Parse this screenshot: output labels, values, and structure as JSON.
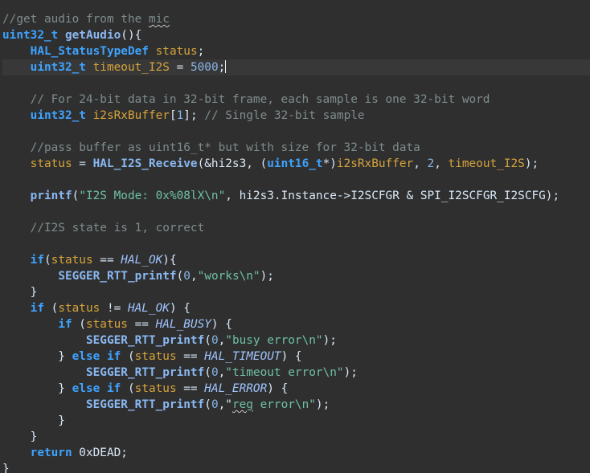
{
  "code": {
    "language": "c",
    "current_line": 4,
    "lines": [
      [
        {
          "t": "//get audio from the ",
          "c": "cm"
        },
        {
          "t": "mic",
          "c": "cm sq"
        }
      ],
      [
        {
          "t": "uint32_t",
          "c": "ty"
        },
        {
          "t": " ",
          "c": "plain"
        },
        {
          "t": "getAudio",
          "c": "fn"
        },
        {
          "t": "(){",
          "c": "plain"
        }
      ],
      [
        {
          "t": "    ",
          "c": "plain"
        },
        {
          "t": "HAL_StatusTypeDef",
          "c": "ty"
        },
        {
          "t": " ",
          "c": "plain"
        },
        {
          "t": "status",
          "c": "var"
        },
        {
          "t": ";",
          "c": "plain"
        }
      ],
      [
        {
          "t": "    ",
          "c": "plain"
        },
        {
          "t": "uint32_t",
          "c": "ty"
        },
        {
          "t": " ",
          "c": "plain"
        },
        {
          "t": "timeout_I2S",
          "c": "var"
        },
        {
          "t": " = ",
          "c": "plain"
        },
        {
          "t": "5000",
          "c": "num"
        },
        {
          "t": ";",
          "c": "plain"
        }
      ],
      [
        {
          "t": "",
          "c": "plain"
        }
      ],
      [
        {
          "t": "    ",
          "c": "plain"
        },
        {
          "t": "// For 24-bit data in 32-bit frame, each sample is one 32-bit word",
          "c": "cm"
        }
      ],
      [
        {
          "t": "    ",
          "c": "plain"
        },
        {
          "t": "uint32_t",
          "c": "ty"
        },
        {
          "t": " ",
          "c": "plain"
        },
        {
          "t": "i2sRxBuffer",
          "c": "var"
        },
        {
          "t": "[",
          "c": "plain"
        },
        {
          "t": "1",
          "c": "num"
        },
        {
          "t": "]; ",
          "c": "plain"
        },
        {
          "t": "// Single 32-bit sample",
          "c": "cm"
        }
      ],
      [
        {
          "t": "",
          "c": "plain"
        }
      ],
      [
        {
          "t": "    ",
          "c": "plain"
        },
        {
          "t": "//pass buffer as uint16_t* but with size for 32-bit data",
          "c": "cm"
        }
      ],
      [
        {
          "t": "    ",
          "c": "plain"
        },
        {
          "t": "status",
          "c": "var"
        },
        {
          "t": " = ",
          "c": "plain"
        },
        {
          "t": "HAL_I2S_Receive",
          "c": "fn"
        },
        {
          "t": "(&hi2s3, (",
          "c": "plain"
        },
        {
          "t": "uint16_t",
          "c": "ty"
        },
        {
          "t": "*)",
          "c": "plain"
        },
        {
          "t": "i2sRxBuffer",
          "c": "var"
        },
        {
          "t": ", ",
          "c": "plain"
        },
        {
          "t": "2",
          "c": "num"
        },
        {
          "t": ", ",
          "c": "plain"
        },
        {
          "t": "timeout_I2S",
          "c": "var"
        },
        {
          "t": ");",
          "c": "plain"
        }
      ],
      [
        {
          "t": "",
          "c": "plain"
        }
      ],
      [
        {
          "t": "    ",
          "c": "plain"
        },
        {
          "t": "printf",
          "c": "fn"
        },
        {
          "t": "(",
          "c": "plain"
        },
        {
          "t": "\"I2S Mode: 0x%08lX\\n\"",
          "c": "str"
        },
        {
          "t": ", hi2s3.Instance->I2SCFGR & SPI_I2SCFGR_I2SCFG);",
          "c": "plain"
        }
      ],
      [
        {
          "t": "",
          "c": "plain"
        }
      ],
      [
        {
          "t": "    ",
          "c": "plain"
        },
        {
          "t": "//I2S state is 1, correct",
          "c": "cm"
        }
      ],
      [
        {
          "t": "",
          "c": "plain"
        }
      ],
      [
        {
          "t": "    ",
          "c": "plain"
        },
        {
          "t": "if",
          "c": "kw"
        },
        {
          "t": "(",
          "c": "plain"
        },
        {
          "t": "status",
          "c": "var"
        },
        {
          "t": " == ",
          "c": "plain"
        },
        {
          "t": "HAL_OK",
          "c": "mac"
        },
        {
          "t": "){",
          "c": "plain"
        }
      ],
      [
        {
          "t": "        ",
          "c": "plain"
        },
        {
          "t": "SEGGER_RTT_printf",
          "c": "fn"
        },
        {
          "t": "(",
          "c": "plain"
        },
        {
          "t": "0",
          "c": "num"
        },
        {
          "t": ",",
          "c": "plain"
        },
        {
          "t": "\"works\\n\"",
          "c": "str"
        },
        {
          "t": ");",
          "c": "plain"
        }
      ],
      [
        {
          "t": "    }",
          "c": "plain"
        }
      ],
      [
        {
          "t": "    ",
          "c": "plain"
        },
        {
          "t": "if",
          "c": "kw"
        },
        {
          "t": " (",
          "c": "plain"
        },
        {
          "t": "status",
          "c": "var"
        },
        {
          "t": " != ",
          "c": "plain"
        },
        {
          "t": "HAL_OK",
          "c": "mac"
        },
        {
          "t": ") {",
          "c": "plain"
        }
      ],
      [
        {
          "t": "        ",
          "c": "plain"
        },
        {
          "t": "if",
          "c": "kw"
        },
        {
          "t": " (",
          "c": "plain"
        },
        {
          "t": "status",
          "c": "var"
        },
        {
          "t": " == ",
          "c": "plain"
        },
        {
          "t": "HAL_BUSY",
          "c": "mac"
        },
        {
          "t": ") {",
          "c": "plain"
        }
      ],
      [
        {
          "t": "            ",
          "c": "plain"
        },
        {
          "t": "SEGGER_RTT_printf",
          "c": "fn"
        },
        {
          "t": "(",
          "c": "plain"
        },
        {
          "t": "0",
          "c": "num"
        },
        {
          "t": ",",
          "c": "plain"
        },
        {
          "t": "\"busy error\\n\"",
          "c": "str"
        },
        {
          "t": ");",
          "c": "plain"
        }
      ],
      [
        {
          "t": "        } ",
          "c": "plain"
        },
        {
          "t": "else if",
          "c": "kw"
        },
        {
          "t": " (",
          "c": "plain"
        },
        {
          "t": "status",
          "c": "var"
        },
        {
          "t": " == ",
          "c": "plain"
        },
        {
          "t": "HAL_TIMEOUT",
          "c": "mac"
        },
        {
          "t": ") {",
          "c": "plain"
        }
      ],
      [
        {
          "t": "            ",
          "c": "plain"
        },
        {
          "t": "SEGGER_RTT_printf",
          "c": "fn"
        },
        {
          "t": "(",
          "c": "plain"
        },
        {
          "t": "0",
          "c": "num"
        },
        {
          "t": ",",
          "c": "plain"
        },
        {
          "t": "\"timeout error\\n\"",
          "c": "str"
        },
        {
          "t": ");",
          "c": "plain"
        }
      ],
      [
        {
          "t": "        } ",
          "c": "plain"
        },
        {
          "t": "else if",
          "c": "kw"
        },
        {
          "t": " (",
          "c": "plain"
        },
        {
          "t": "status",
          "c": "var"
        },
        {
          "t": " == ",
          "c": "plain"
        },
        {
          "t": "HAL_ERROR",
          "c": "mac"
        },
        {
          "t": ") {",
          "c": "plain"
        }
      ],
      [
        {
          "t": "            ",
          "c": "plain"
        },
        {
          "t": "SEGGER_RTT_printf",
          "c": "fn"
        },
        {
          "t": "(",
          "c": "plain"
        },
        {
          "t": "0",
          "c": "num"
        },
        {
          "t": ",\"",
          "c": "plain str"
        },
        {
          "t": "reg",
          "c": "str sq"
        },
        {
          "t": " error\\n\"",
          "c": "str"
        },
        {
          "t": ");",
          "c": "plain"
        }
      ],
      [
        {
          "t": "        }",
          "c": "plain"
        }
      ],
      [
        {
          "t": "    }",
          "c": "plain"
        }
      ],
      [
        {
          "t": "    ",
          "c": "plain"
        },
        {
          "t": "return",
          "c": "kw"
        },
        {
          "t": " 0xDEAD;",
          "c": "plain"
        }
      ],
      [
        {
          "t": "}",
          "c": "plain"
        }
      ]
    ]
  },
  "colors": {
    "background": "#2f2f2f",
    "current_line": "#383838",
    "comment": "#7f8c8d",
    "keyword": "#3ea3ff",
    "function": "#8ab8f2",
    "variable": "#d7a43a",
    "string": "#6fc0a6",
    "number": "#8ab4e8",
    "text": "#d9e8f7"
  }
}
